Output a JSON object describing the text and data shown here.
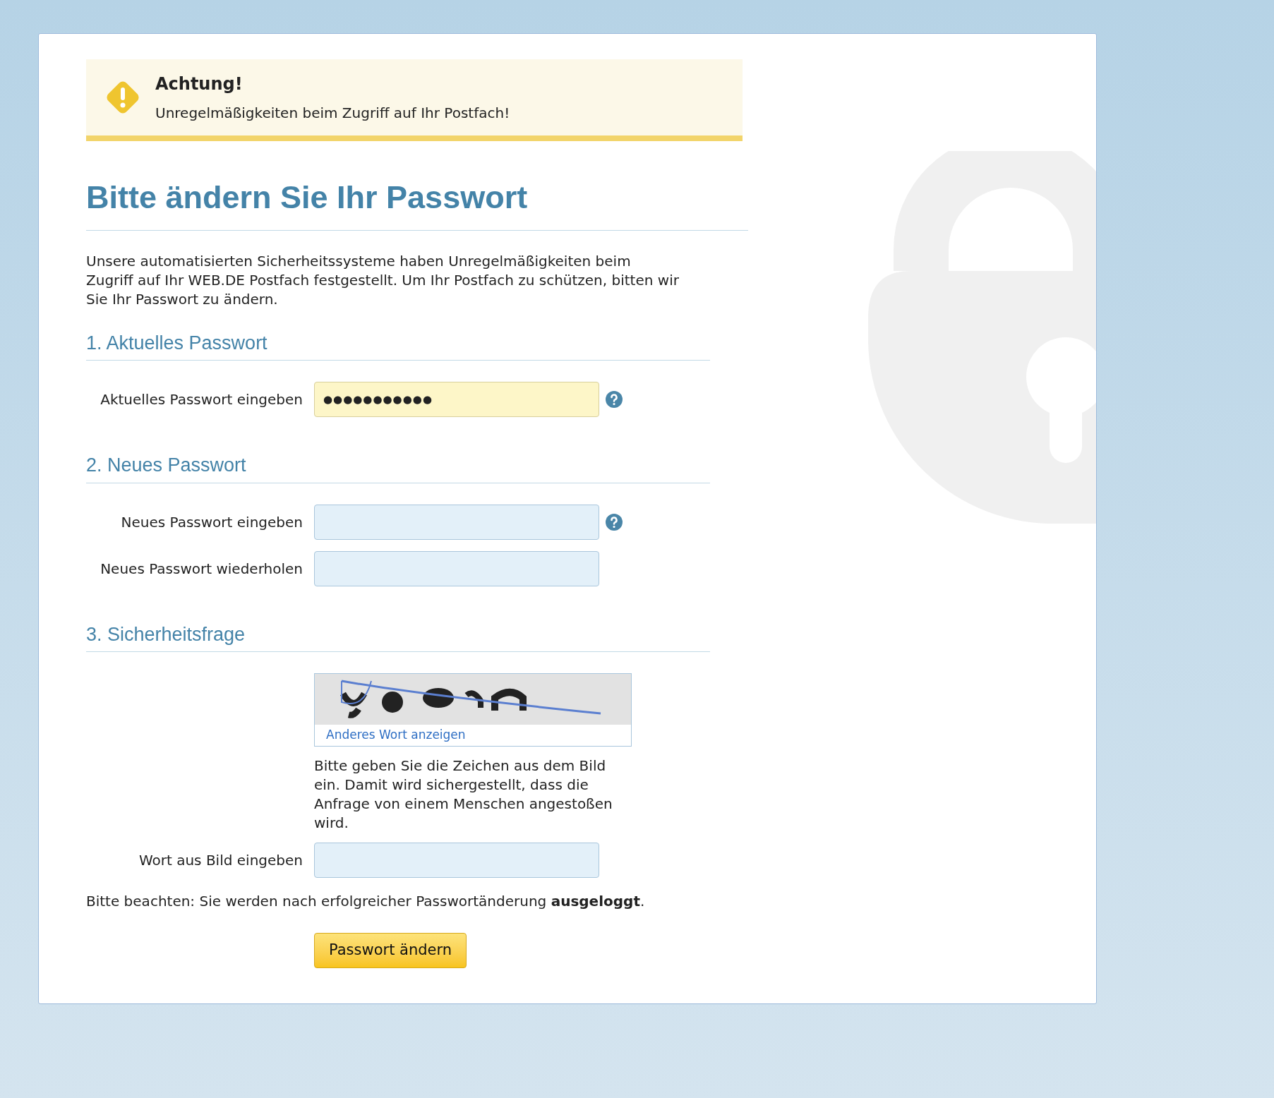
{
  "alert": {
    "title": "Achtung!",
    "message": "Unregelmäßigkeiten beim Zugriff auf Ihr Postfach!"
  },
  "heading": "Bitte ändern Sie Ihr Passwort",
  "intro": "Unsere automatisierten Sicherheitssysteme haben Unregelmäßigkeiten beim Zugriff auf Ihr WEB.DE Postfach festgestellt. Um Ihr Postfach zu schützen, bitten wir Sie Ihr Passwort zu ändern.",
  "sections": [
    {
      "title": "1. Aktuelles Passwort",
      "fields": [
        {
          "label": "Aktuelles Passwort eingeben",
          "value": "●●●●●●●●●●●",
          "autofilled": true,
          "help": true
        }
      ]
    },
    {
      "title": "2. Neues Passwort",
      "fields": [
        {
          "label": "Neues Passwort eingeben",
          "autofilled": false,
          "help": true
        },
        {
          "label": "Neues Passwort wiederholen",
          "autofilled": false,
          "help": false
        }
      ]
    },
    {
      "title": "3. Sicherheitsfrage",
      "captcha": {
        "kind": "picture",
        "link": "Anderes Wort anzeigen",
        "hint": "Bitte geben Sie die Zeichen aus dem Bild ein. Damit wird sichergestellt, dass die Anfrage von einem Menschen angestoßen wird."
      },
      "fields": [
        {
          "label": "Wort aus Bild eingeben",
          "autofilled": false,
          "help": false
        }
      ]
    }
  ],
  "note": "Bitte beachten: Sie werden nach erfolgreicher Passwortänderung **ausgeloggt**.",
  "submit": "Passwort ändern"
}
